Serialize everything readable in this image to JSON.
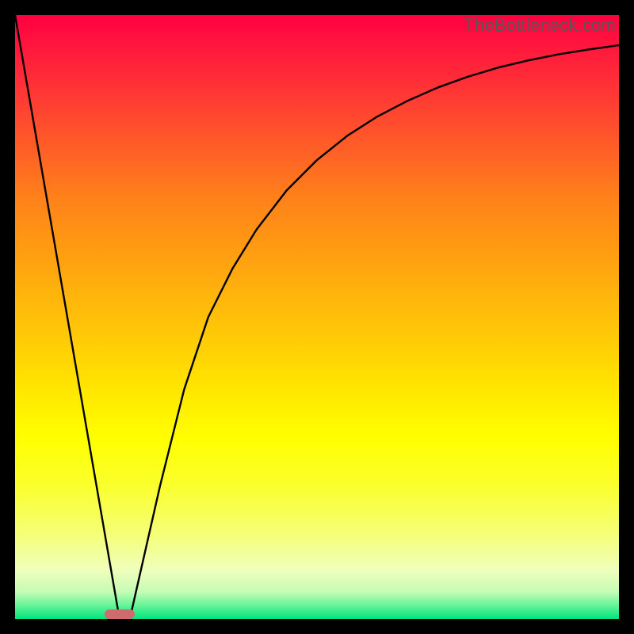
{
  "watermark": {
    "text": "TheBottleneck.com"
  },
  "chart_data": {
    "type": "line",
    "title": "",
    "xlabel": "",
    "ylabel": "",
    "xlim": [
      0,
      100
    ],
    "ylim": [
      0,
      100
    ],
    "grid": false,
    "series": [
      {
        "name": "bottleneck-curve",
        "x": [
          0,
          17.3,
          19.0,
          24,
          28,
          32,
          36,
          40,
          45,
          50,
          55,
          60,
          65,
          70,
          75,
          80,
          85,
          90,
          95,
          100
        ],
        "y": [
          100,
          0,
          0,
          22,
          38,
          50,
          58,
          64.5,
          71,
          76,
          80,
          83.2,
          85.8,
          88,
          89.8,
          91.3,
          92.5,
          93.5,
          94.3,
          95
        ]
      }
    ],
    "sweet_spot": {
      "x_center": 17.3,
      "width_pct": 5.0
    },
    "background_gradient": {
      "top": "#ff0040",
      "mid": "#ffff00",
      "bottom": "#00e57e"
    }
  }
}
